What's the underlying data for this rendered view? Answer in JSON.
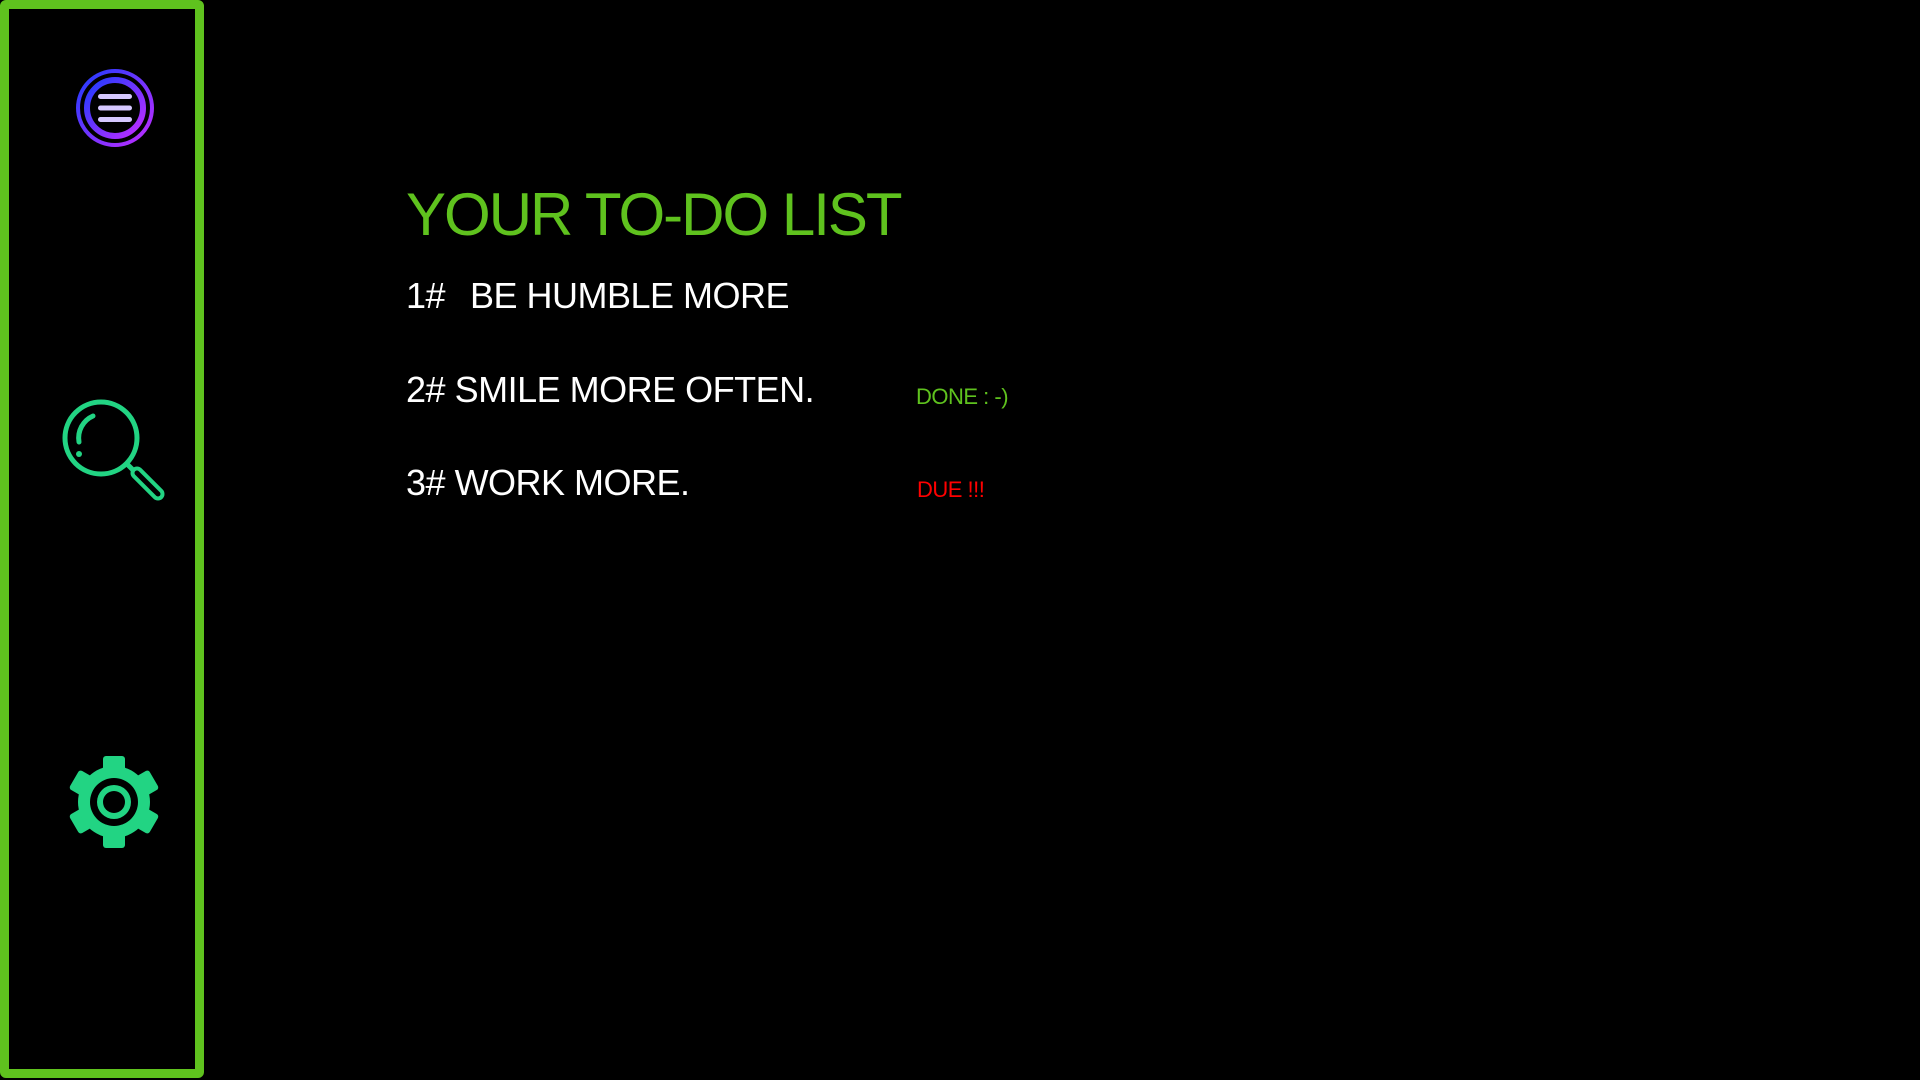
{
  "colors": {
    "accent": "#5fc21e",
    "icon": "#22d483",
    "done": "#5fc21e",
    "due": "#ff0000",
    "menu_gradient": [
      "#1e3cff",
      "#b42cff"
    ]
  },
  "sidebar": {
    "icons": [
      "menu-icon",
      "search-icon",
      "gear-icon"
    ]
  },
  "main": {
    "title": "YOUR TO-DO LIST",
    "todos": [
      {
        "number": "1#",
        "text": "BE HUMBLE MORE",
        "status": ""
      },
      {
        "number": "2#",
        "text": "SMILE MORE OFTEN.",
        "status": "DONE : -)"
      },
      {
        "number": "3#",
        "text": "WORK MORE.",
        "status": "DUE !!!"
      }
    ]
  }
}
